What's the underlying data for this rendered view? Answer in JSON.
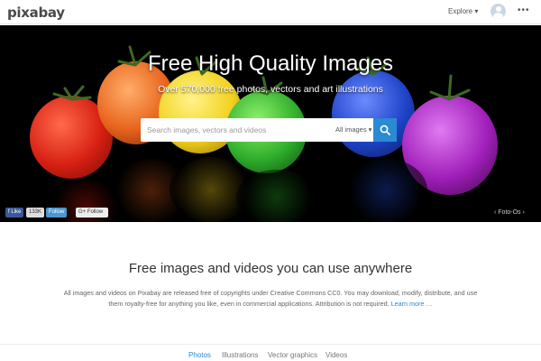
{
  "header": {
    "logo_text": "pixabay",
    "explore_label": "Explore ▾",
    "more_label": "•••"
  },
  "hero": {
    "title": "Free High Quality Images",
    "subtitle": "Over 570,000 free photos, vectors and art illustrations",
    "search_placeholder": "Search images, vectors and videos",
    "search_type_label": "All images ▾",
    "credit_label": "‹  Foto-Os  ›"
  },
  "social": {
    "like_label": "f Like",
    "like_count": "133K",
    "follow_twitter_label": "Follow",
    "follow_gplus_label": "G+ Follow"
  },
  "intro": {
    "title": "Free images and videos you can use anywhere",
    "text": "All images and videos on Pixabay are released free of copyrights under Creative Commons CC0. You may download, modify, distribute, and use them royalty-free for anything you like, even in commercial applications. Attribution is not required.",
    "learn_more": "Learn more …"
  },
  "tabs": {
    "photos": "Photos",
    "illustrations": "Illustrations",
    "vectors": "Vector graphics",
    "videos": "Videos"
  },
  "colors": {
    "accent": "#2a8ad4",
    "tomato_red": "#d61f12",
    "tomato_orange": "#e8641c",
    "tomato_yellow": "#f2d21e",
    "tomato_green": "#2fae2c",
    "tomato_blue": "#1f43c8",
    "tomato_purple": "#a01fb9"
  }
}
